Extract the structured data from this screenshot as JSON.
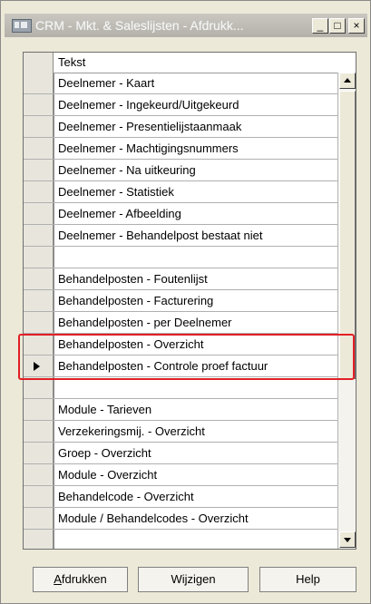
{
  "window": {
    "title": "CRM - Mkt. & Saleslijsten - Afdrukk...",
    "controls": {
      "minimize": "_",
      "maximize": "□",
      "close": "×"
    }
  },
  "grid": {
    "column_header": "Tekst",
    "rows": [
      {
        "text": "Deelnemer - Kaart"
      },
      {
        "text": "Deelnemer - Ingekeurd/Uitgekeurd"
      },
      {
        "text": "Deelnemer - Presentielijstaanmaak"
      },
      {
        "text": "Deelnemer - Machtigingsnummers"
      },
      {
        "text": "Deelnemer - Na uitkeuring"
      },
      {
        "text": "Deelnemer - Statistiek"
      },
      {
        "text": "Deelnemer - Afbeelding"
      },
      {
        "text": "Deelnemer - Behandelpost bestaat niet"
      },
      {
        "text": ""
      },
      {
        "text": "Behandelposten - Foutenlijst"
      },
      {
        "text": "Behandelposten - Facturering"
      },
      {
        "text": "Behandelposten - per Deelnemer"
      },
      {
        "text": "Behandelposten - Overzicht"
      },
      {
        "text": "Behandelposten - Controle proef factuur",
        "current": true
      },
      {
        "text": ""
      },
      {
        "text": "Module - Tarieven"
      },
      {
        "text": "Verzekeringsmij. - Overzicht"
      },
      {
        "text": "Groep - Overzicht"
      },
      {
        "text": "Module - Overzicht"
      },
      {
        "text": "Behandelcode - Overzicht"
      },
      {
        "text": "Module / Behandelcodes - Overzicht"
      },
      {
        "text": ""
      }
    ]
  },
  "buttons": {
    "print": {
      "accel": "A",
      "rest": "fdrukken"
    },
    "edit": {
      "label": "Wijzigen"
    },
    "help": {
      "label": "Help"
    }
  },
  "colors": {
    "highlight_box": "#e21f26"
  }
}
